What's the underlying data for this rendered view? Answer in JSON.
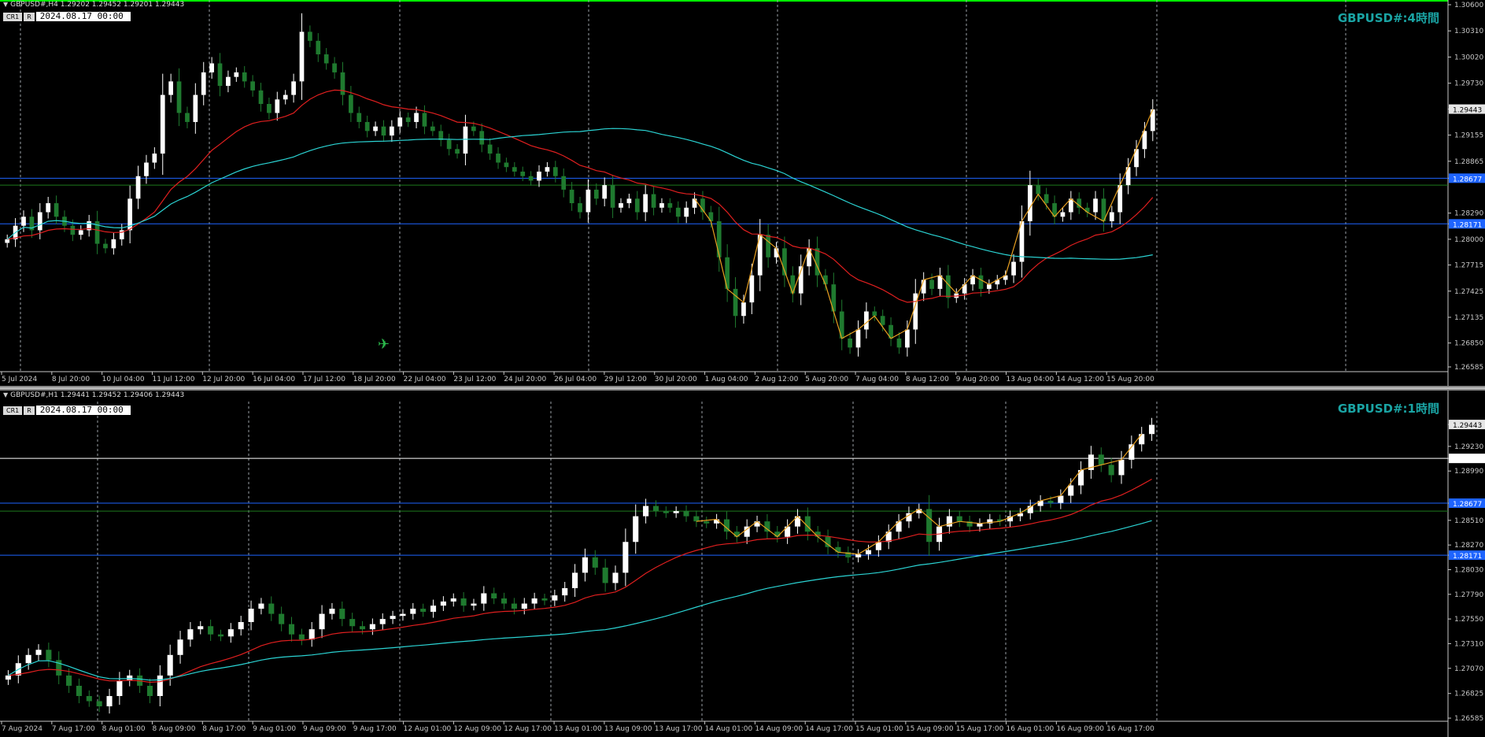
{
  "panes": [
    {
      "id": "h4",
      "header": "GBPUSD#,H4  1.29202 1.29452 1.29201 1.29443",
      "buttons": [
        "CR1",
        "R"
      ],
      "date_value": "2024.08.17 00:00",
      "big_label": "GBPUSD#:4時間",
      "price_labels": [
        "1.30600",
        "1.30310",
        "1.30020",
        "1.29730",
        "1.29443",
        "1.29155",
        "1.28865",
        "1.28677",
        "1.28290",
        "1.28171",
        "1.28000",
        "1.27715",
        "1.27425",
        "1.27135",
        "1.26850",
        "1.26585"
      ],
      "time_labels": [
        "5 Jul 2024",
        "8 Jul 20:00",
        "10 Jul 04:00",
        "11 Jul 12:00",
        "12 Jul 20:00",
        "16 Jul 04:00",
        "17 Jul 12:00",
        "18 Jul 20:00",
        "22 Jul 04:00",
        "23 Jul 12:00",
        "24 Jul 20:00",
        "26 Jul 04:00",
        "29 Jul 12:00",
        "30 Jul 20:00",
        "1 Aug 04:00",
        "2 Aug 12:00",
        "5 Aug 20:00",
        "7 Aug 04:00",
        "8 Aug 12:00",
        "9 Aug 20:00",
        "13 Aug 04:00",
        "14 Aug 12:00",
        "15 Aug 20:00"
      ],
      "chart_data": {
        "type": "candlestick",
        "title": "GBPUSD#:4時間",
        "ylim": [
          1.2655,
          1.306
        ],
        "closes": [
          1.28,
          1.2815,
          1.2825,
          1.281,
          1.283,
          1.284,
          1.2825,
          1.2815,
          1.2805,
          1.281,
          1.282,
          1.2795,
          1.279,
          1.28,
          1.281,
          1.2845,
          1.287,
          1.2885,
          1.2895,
          1.296,
          1.2975,
          1.294,
          1.293,
          1.296,
          1.2985,
          1.2995,
          1.297,
          1.298,
          1.2985,
          1.2975,
          1.2965,
          1.295,
          1.294,
          1.2955,
          1.296,
          1.2975,
          1.303,
          1.302,
          1.3005,
          1.2995,
          1.2985,
          1.296,
          1.294,
          1.293,
          1.292,
          1.2925,
          1.2915,
          1.2925,
          1.2935,
          1.293,
          1.294,
          1.2925,
          1.292,
          1.291,
          1.29,
          1.2895,
          1.2925,
          1.292,
          1.2905,
          1.2895,
          1.2885,
          1.288,
          1.2875,
          1.287,
          1.2865,
          1.2875,
          1.288,
          1.287,
          1.2855,
          1.284,
          1.283,
          1.2855,
          1.2845,
          1.286,
          1.2835,
          1.284,
          1.2845,
          1.283,
          1.285,
          1.2835,
          1.284,
          1.2835,
          1.2825,
          1.2835,
          1.2845,
          1.283,
          1.282,
          1.278,
          1.2745,
          1.2715,
          1.273,
          1.276,
          1.2805,
          1.278,
          1.279,
          1.276,
          1.274,
          1.277,
          1.279,
          1.276,
          1.275,
          1.272,
          1.269,
          1.268,
          1.27,
          1.272,
          1.2715,
          1.2705,
          1.269,
          1.268,
          1.27,
          1.274,
          1.2755,
          1.2745,
          1.276,
          1.2735,
          1.274,
          1.275,
          1.276,
          1.2745,
          1.275,
          1.2755,
          1.276,
          1.2775,
          1.282,
          1.286,
          1.285,
          1.284,
          1.2825,
          1.283,
          1.2845,
          1.2835,
          1.283,
          1.2845,
          1.282,
          1.283,
          1.286,
          1.288,
          1.29,
          1.292,
          1.2944
        ],
        "series": [
          {
            "name": "",
            "color": "#e01f1f"
          },
          {
            "name": "",
            "color": "#2bd4d4"
          },
          {
            "name": "",
            "color": "#e8a020"
          }
        ],
        "hlines": [
          {
            "value": 1.28677,
            "color": "#1e64ff"
          },
          {
            "value": 1.286,
            "color": "#1e7a1e"
          },
          {
            "value": 1.28171,
            "color": "#1e64ff"
          }
        ]
      }
    },
    {
      "id": "h1",
      "header": "GBPUSD#,H1  1.29441 1.29452 1.29406 1.29443",
      "buttons": [
        "CR1",
        "R"
      ],
      "date_value": "2024.08.17 00:00",
      "big_label": "GBPUSD#:1時間",
      "price_labels": [
        "1.29443",
        "1.29230",
        "1.29113",
        "1.28990",
        "1.28677",
        "1.28510",
        "1.28270",
        "1.28171",
        "1.28030",
        "1.27790",
        "1.27550",
        "1.27310",
        "1.27070",
        "1.26825",
        "1.26585"
      ],
      "time_labels": [
        "7 Aug 2024",
        "7 Aug 17:00",
        "8 Aug 01:00",
        "8 Aug 09:00",
        "8 Aug 17:00",
        "9 Aug 01:00",
        "9 Aug 09:00",
        "9 Aug 17:00",
        "12 Aug 01:00",
        "12 Aug 09:00",
        "12 Aug 17:00",
        "13 Aug 01:00",
        "13 Aug 09:00",
        "13 Aug 17:00",
        "14 Aug 01:00",
        "14 Aug 09:00",
        "14 Aug 17:00",
        "15 Aug 01:00",
        "15 Aug 09:00",
        "15 Aug 17:00",
        "16 Aug 01:00",
        "16 Aug 09:00",
        "16 Aug 17:00"
      ],
      "chart_data": {
        "type": "candlestick",
        "title": "GBPUSD#:1時間",
        "ylim": [
          1.2657,
          1.2962
        ],
        "closes": [
          1.27,
          1.2712,
          1.272,
          1.2725,
          1.2715,
          1.27,
          1.269,
          1.268,
          1.2675,
          1.267,
          1.268,
          1.2695,
          1.27,
          1.269,
          1.268,
          1.27,
          1.272,
          1.2735,
          1.2745,
          1.2748,
          1.274,
          1.2738,
          1.2745,
          1.2752,
          1.2765,
          1.277,
          1.276,
          1.275,
          1.274,
          1.2735,
          1.2745,
          1.276,
          1.2765,
          1.2755,
          1.2748,
          1.2745,
          1.275,
          1.2755,
          1.2758,
          1.276,
          1.2765,
          1.2762,
          1.2768,
          1.2772,
          1.2775,
          1.2768,
          1.277,
          1.278,
          1.2775,
          1.277,
          1.2765,
          1.277,
          1.2775,
          1.2773,
          1.2778,
          1.2785,
          1.28,
          1.2815,
          1.2805,
          1.279,
          1.28,
          1.283,
          1.2855,
          1.2865,
          1.286,
          1.2858,
          1.286,
          1.2855,
          1.285,
          1.2848,
          1.2852,
          1.284,
          1.2835,
          1.2845,
          1.285,
          1.284,
          1.2835,
          1.2845,
          1.2855,
          1.284,
          1.2835,
          1.2825,
          1.282,
          1.2815,
          1.2818,
          1.2822,
          1.283,
          1.284,
          1.285,
          1.2858,
          1.2862,
          1.283,
          1.2845,
          1.2855,
          1.285,
          1.2845,
          1.2848,
          1.2852,
          1.285,
          1.2855,
          1.2858,
          1.2865,
          1.287,
          1.2868,
          1.2875,
          1.2885,
          1.29,
          1.2915,
          1.2905,
          1.2895,
          1.291,
          1.2925,
          1.2935,
          1.2944
        ],
        "series": [
          {
            "name": "",
            "color": "#e01f1f"
          },
          {
            "name": "",
            "color": "#2bd4d4"
          },
          {
            "name": "",
            "color": "#e8a020"
          }
        ],
        "hlines": [
          {
            "value": 1.29113,
            "color": "#ffffff"
          },
          {
            "value": 1.28677,
            "color": "#1e64ff"
          },
          {
            "value": 1.286,
            "color": "#1e7a1e"
          },
          {
            "value": 1.28171,
            "color": "#1e64ff"
          }
        ]
      }
    }
  ],
  "colors": {
    "bull": "#ffffff",
    "bear": "#1f7a2f",
    "grid": "#9aa0a6",
    "axis": "#c8c8c8",
    "border_top": "#00ff00",
    "highlight_label_bg": "#1e64ff",
    "price_label_bg": "#e6e6e6"
  },
  "icons": {
    "cursor": "satellite-icon"
  }
}
